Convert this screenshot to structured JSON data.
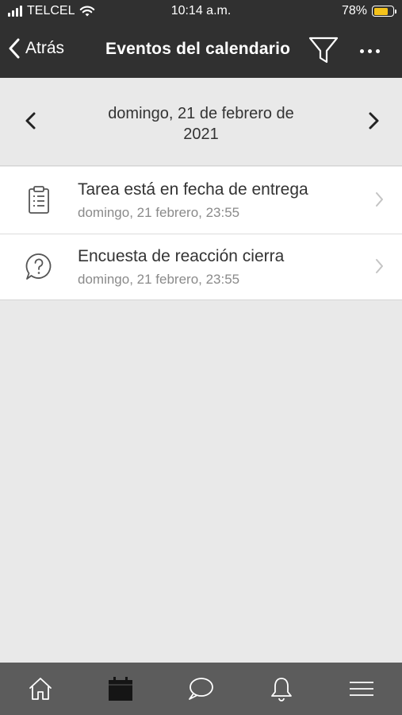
{
  "status_bar": {
    "carrier": "TELCEL",
    "time": "10:14 a.m.",
    "battery": "78%",
    "battery_level": 0.78,
    "battery_color": "#f4c21a"
  },
  "nav": {
    "back_label": "Atrás",
    "title": "Eventos del calendario",
    "filter_icon": "filter-icon",
    "more_icon": "more-icon"
  },
  "date_header": {
    "date_line1": "domingo, 21 de febrero de",
    "date_line2": "2021"
  },
  "events": [
    {
      "title": "Tarea está en fecha de entrega",
      "date": "domingo, 21 febrero, 23:55",
      "icon": "assignment-icon"
    },
    {
      "title": "Encuesta de reacción cierra",
      "date": "domingo, 21 febrero, 23:55",
      "icon": "feedback-question-icon"
    }
  ],
  "tabs": [
    {
      "icon": "home-icon",
      "selected": false
    },
    {
      "icon": "calendar-icon",
      "selected": true
    },
    {
      "icon": "messages-icon",
      "selected": false
    },
    {
      "icon": "notifications-icon",
      "selected": false
    },
    {
      "icon": "menu-icon",
      "selected": false
    }
  ],
  "colors": {
    "header_bg": "#303030",
    "tabbar_bg": "#5c5c5c",
    "page_bg": "#e9e9e9"
  }
}
